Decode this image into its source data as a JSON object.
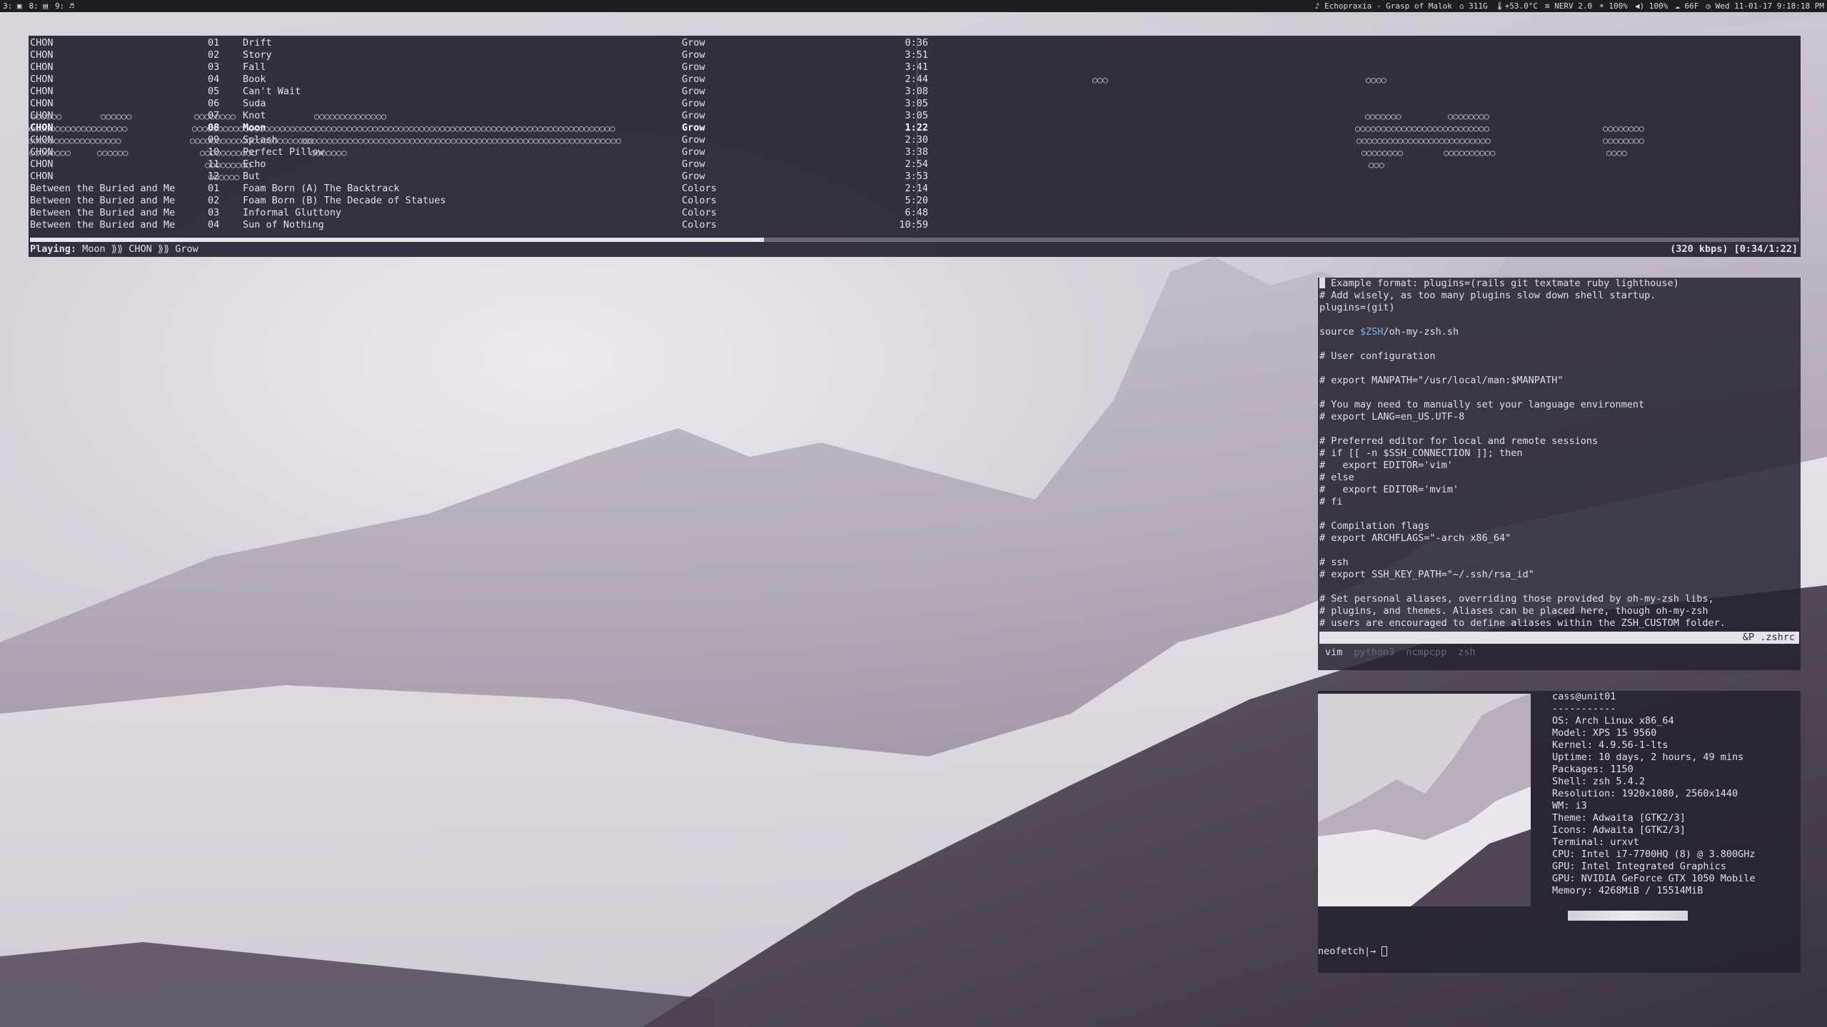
{
  "topbar": {
    "workspaces": [
      "3:",
      "8:",
      "9:"
    ],
    "now_playing": "♪ Echopraxia - Grasp of Malok",
    "disk": "311G",
    "temp": "+53.0°C",
    "wifi": "NERV 2.0",
    "brightness": "100%",
    "volume": "100%",
    "weather": "66F",
    "datetime": "Wed 11-01-17 9:18:18 PM"
  },
  "player": {
    "tracks": [
      {
        "artist": "CHON",
        "num": "01",
        "title": "Drift",
        "album": "Grow",
        "time": "0:36"
      },
      {
        "artist": "CHON",
        "num": "02",
        "title": "Story",
        "album": "Grow",
        "time": "3:51"
      },
      {
        "artist": "CHON",
        "num": "03",
        "title": "Fall",
        "album": "Grow",
        "time": "3:41"
      },
      {
        "artist": "CHON",
        "num": "04",
        "title": "Book",
        "album": "Grow",
        "time": "2:44"
      },
      {
        "artist": "CHON",
        "num": "05",
        "title": "Can't Wait",
        "album": "Grow",
        "time": "3:08"
      },
      {
        "artist": "CHON",
        "num": "06",
        "title": "Suda",
        "album": "Grow",
        "time": "3:05"
      },
      {
        "artist": "CHON",
        "num": "07",
        "title": "Knot",
        "album": "Grow",
        "time": "3:05"
      },
      {
        "artist": "CHON",
        "num": "08",
        "title": "Moon",
        "album": "Grow",
        "time": "1:22",
        "active": true
      },
      {
        "artist": "CHON",
        "num": "09",
        "title": "Splash",
        "album": "Grow",
        "time": "2:30"
      },
      {
        "artist": "CHON",
        "num": "10",
        "title": "Perfect Pillow",
        "album": "Grow",
        "time": "3:38"
      },
      {
        "artist": "CHON",
        "num": "11",
        "title": "Echo",
        "album": "Grow",
        "time": "2:54"
      },
      {
        "artist": "CHON",
        "num": "12",
        "title": "But",
        "album": "Grow",
        "time": "3:53"
      },
      {
        "artist": "Between the Buried and Me",
        "num": "01",
        "title": "Foam Born (A) The Backtrack",
        "album": "Colors",
        "time": "2:14"
      },
      {
        "artist": "Between the Buried and Me",
        "num": "02",
        "title": "Foam Born (B) The Decade of Statues",
        "album": "Colors",
        "time": "5:20"
      },
      {
        "artist": "Between the Buried and Me",
        "num": "03",
        "title": "Informal Gluttony",
        "album": "Colors",
        "time": "6:48"
      },
      {
        "artist": "Between the Buried and Me",
        "num": "04",
        "title": "Sun of Nothing",
        "album": "Colors",
        "time": "10:59"
      }
    ],
    "progress_fraction": 0.415,
    "status": {
      "label": "Playing:",
      "song": "Moon",
      "sep": "⟫⟫",
      "artist": "CHON",
      "album": "Grow",
      "bitrate_time": "(320 kbps) [0:34/1:22]"
    }
  },
  "vim": {
    "lines": [
      [
        {
          "t": "",
          "cursor": true
        },
        {
          "t": " Example format: plugins=(rails git textmate ruby lighthouse)"
        }
      ],
      [
        {
          "t": "# Add wisely, as too many plugins slow down shell startup."
        }
      ],
      [
        {
          "t": "plugins=(git)"
        }
      ],
      [
        {
          "t": ""
        }
      ],
      [
        {
          "t": "source "
        },
        {
          "t": "$ZSH",
          "kw": true
        },
        {
          "t": "/oh-my-zsh.sh"
        }
      ],
      [
        {
          "t": ""
        }
      ],
      [
        {
          "t": "# User configuration"
        }
      ],
      [
        {
          "t": ""
        }
      ],
      [
        {
          "t": "# export MANPATH=\"/usr/local/man:$MANPATH\""
        }
      ],
      [
        {
          "t": ""
        }
      ],
      [
        {
          "t": "# You may need to manually set your language environment"
        }
      ],
      [
        {
          "t": "# export LANG=en_US.UTF-8"
        }
      ],
      [
        {
          "t": ""
        }
      ],
      [
        {
          "t": "# Preferred editor for local and remote sessions"
        }
      ],
      [
        {
          "t": "# if [[ -n $SSH_CONNECTION ]]; then"
        }
      ],
      [
        {
          "t": "#   export EDITOR='vim'"
        }
      ],
      [
        {
          "t": "# else"
        }
      ],
      [
        {
          "t": "#   export EDITOR='mvim'"
        }
      ],
      [
        {
          "t": "# fi"
        }
      ],
      [
        {
          "t": ""
        }
      ],
      [
        {
          "t": "# Compilation flags"
        }
      ],
      [
        {
          "t": "# export ARCHFLAGS=\"-arch x86_64\""
        }
      ],
      [
        {
          "t": ""
        }
      ],
      [
        {
          "t": "# ssh"
        }
      ],
      [
        {
          "t": "# export SSH_KEY_PATH=\"~/.ssh/rsa_id\""
        }
      ],
      [
        {
          "t": ""
        }
      ],
      [
        {
          "t": "# Set personal aliases, overriding those provided by oh-my-zsh libs,"
        }
      ],
      [
        {
          "t": "# plugins, and themes. Aliases can be placed here, though oh-my-zsh"
        }
      ],
      [
        {
          "t": "# users are encouraged to define aliases within the ZSH_CUSTOM folder."
        }
      ]
    ],
    "statusline": "&P .zshrc",
    "tmux_tabs": [
      "vim",
      "python3",
      "ncmpcpp",
      "zsh"
    ],
    "tmux_active": 0
  },
  "neofetch": {
    "header": "cass@unit01",
    "underline": "-----------",
    "info": [
      "OS: Arch Linux x86_64",
      "Model: XPS 15 9560",
      "Kernel: 4.9.56-1-lts",
      "Uptime: 10 days, 2 hours, 49 mins",
      "Packages: 1150",
      "Shell: zsh 5.4.2",
      "Resolution: 1920x1080, 2560x1440",
      "WM: i3",
      "Theme: Adwaita [GTK2/3]",
      "Icons: Adwaita [GTK2/3]",
      "Terminal: urxvt",
      "CPU: Intel i7-7700HQ (8) @ 3.800GHz",
      "GPU: Intel Integrated Graphics",
      "GPU: NVIDIA GeForce GTX 1050 Mobile",
      "Memory: 4268MiB / 15514MiB"
    ],
    "prompt": "neofetch|→ "
  },
  "colors": {
    "panel": "#282534",
    "text": "#e4e0ea",
    "keyword": "#74b7e8"
  }
}
